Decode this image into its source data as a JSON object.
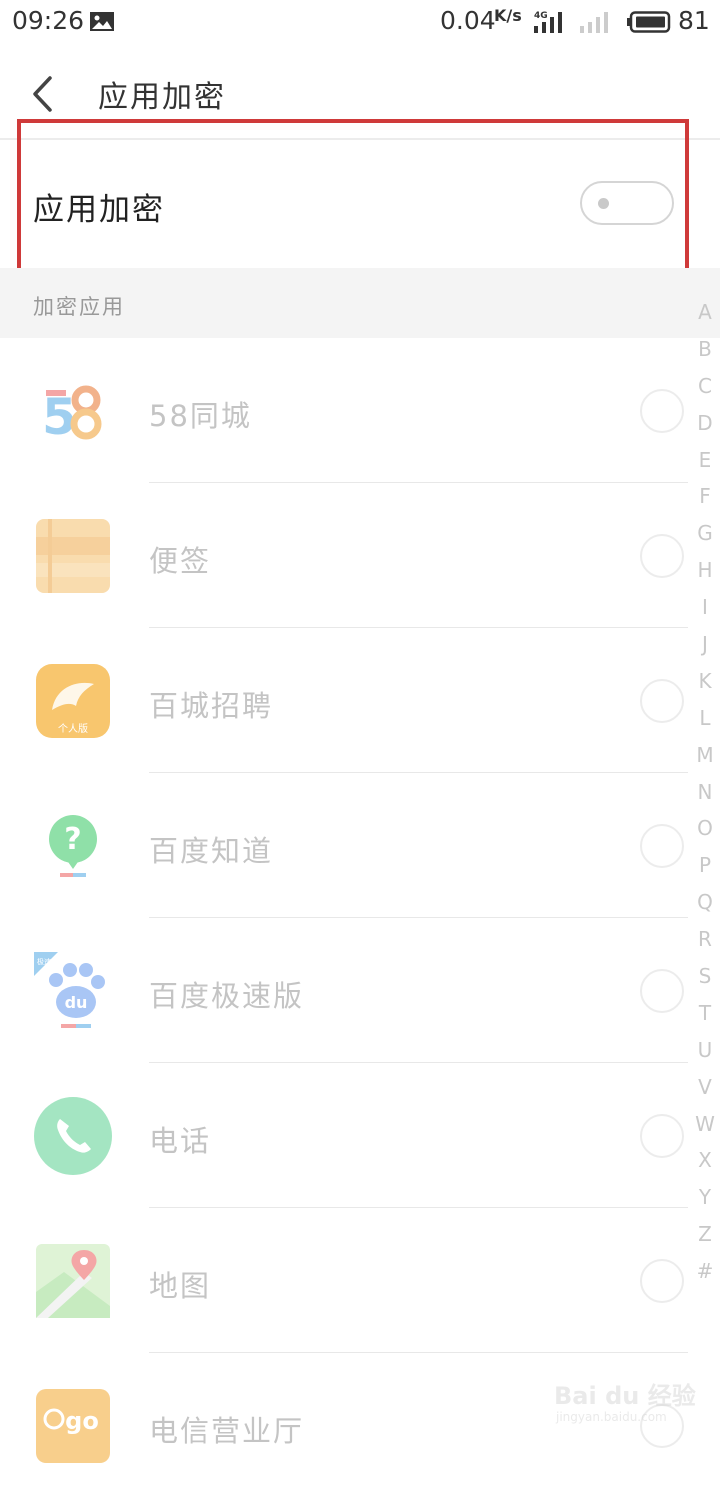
{
  "status_bar": {
    "time": "09:26",
    "net_speed": "0.04",
    "net_speed_unit": "K/s",
    "network_type": "4G",
    "battery": "81",
    "icons": [
      "image-icon",
      "signal-4g-icon",
      "signal-empty-icon",
      "battery-icon"
    ]
  },
  "header": {
    "title": "应用加密",
    "back_icon": "back-arrow-icon"
  },
  "toggle": {
    "label": "应用加密",
    "enabled": false
  },
  "section": {
    "title": "加密应用"
  },
  "apps": [
    {
      "name": "58同城",
      "icon": "app-58-icon",
      "checked": false
    },
    {
      "name": "便签",
      "icon": "notes-icon",
      "checked": false
    },
    {
      "name": "百城招聘",
      "icon": "baicheng-recruit-icon",
      "icon_text": "个人版",
      "checked": false
    },
    {
      "name": "百度知道",
      "icon": "baidu-zhidao-icon",
      "checked": false
    },
    {
      "name": "百度极速版",
      "icon": "baidu-lite-icon",
      "icon_badge": "极速",
      "icon_text": "du",
      "checked": false
    },
    {
      "name": "电话",
      "icon": "phone-icon",
      "checked": false
    },
    {
      "name": "地图",
      "icon": "map-icon",
      "checked": false
    },
    {
      "name": "电信营业厅",
      "icon": "telecom-icon",
      "icon_text": "go",
      "checked": false
    }
  ],
  "alpha_index": [
    "A",
    "B",
    "C",
    "D",
    "E",
    "F",
    "G",
    "H",
    "I",
    "J",
    "K",
    "L",
    "M",
    "N",
    "O",
    "P",
    "Q",
    "R",
    "S",
    "T",
    "U",
    "V",
    "W",
    "X",
    "Y",
    "Z",
    "#"
  ],
  "colors": {
    "highlight_border": "#cf3a3a",
    "section_bg": "#f4f4f4",
    "app_text": "#c4c4c4"
  },
  "watermark": {
    "main": "Bai du 经验",
    "sub": "jingyan.baidu.com"
  }
}
